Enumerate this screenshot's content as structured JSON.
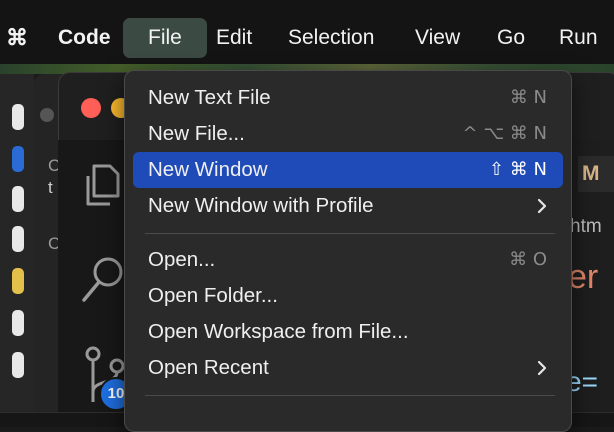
{
  "menubar": {
    "app_name": "Code",
    "items": [
      "File",
      "Edit",
      "Selection",
      "View",
      "Go",
      "Run"
    ],
    "active_item": "File"
  },
  "file_menu": {
    "items": [
      {
        "label": "New Text File",
        "shortcut": "⌘ N",
        "highlighted": false
      },
      {
        "label": "New File...",
        "shortcut": "^ ⌥ ⌘ N",
        "highlighted": false
      },
      {
        "label": "New Window",
        "shortcut": "⇧ ⌘ N",
        "highlighted": true
      },
      {
        "label": "New Window with Profile",
        "submenu": true
      },
      {
        "label": "Open...",
        "shortcut": "⌘ O"
      },
      {
        "label": "Open Folder..."
      },
      {
        "label": "Open Workspace from File..."
      },
      {
        "label": "Open Recent",
        "submenu": true
      }
    ]
  },
  "vscode": {
    "scm_badge": "10",
    "traffic_lights": {
      "close": "#ff5f57",
      "minimize": "#febc2e"
    }
  },
  "background": {
    "peek_tab_letter": "M",
    "peek_text_1": "htm",
    "peek_text_2": "er",
    "peek_text_3": "e=",
    "left_window_text_1": "C",
    "left_window_text_2": "t",
    "left_window_text_3": "C"
  },
  "colors": {
    "highlight": "#1f4bb8",
    "menu_bg": "#2a2a2a",
    "accent_badge": "#1e6fe0"
  }
}
